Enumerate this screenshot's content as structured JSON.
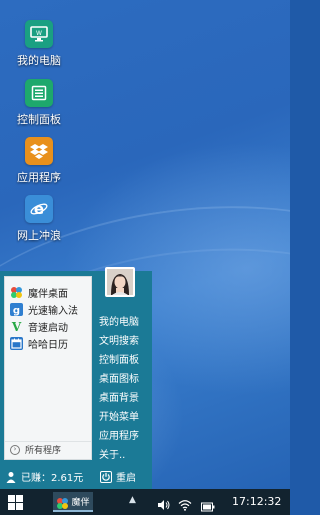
{
  "desktop": {
    "icons": [
      {
        "label": "我的电脑",
        "icon": "computer-icon",
        "color": "#1aa082"
      },
      {
        "label": "控制面板",
        "icon": "control-panel-icon",
        "color": "#1ea86c"
      },
      {
        "label": "应用程序",
        "icon": "dropbox-icon",
        "color": "#e8901c"
      },
      {
        "label": "网上冲浪",
        "icon": "internet-explorer-icon",
        "color": "#3a8ed8"
      }
    ]
  },
  "start_menu": {
    "apps": [
      {
        "label": "魔伴桌面",
        "icon": "pinwheel-icon"
      },
      {
        "label": "光速输入法",
        "icon": "input-method-icon"
      },
      {
        "label": "音速启动",
        "icon": "v-launcher-icon"
      },
      {
        "label": "哈哈日历",
        "icon": "calendar-icon"
      }
    ],
    "all_programs": "所有程序",
    "right_items": [
      "我的电脑",
      "文明搜索",
      "控制面板",
      "桌面图标",
      "桌面背景",
      "开始菜单",
      "应用程序",
      "关于.."
    ],
    "earned": "已赚：2.61元",
    "restart": "重启"
  },
  "taskbar": {
    "app_label": "魔伴",
    "time": "17:12:32"
  },
  "colors": {
    "menu_bg": "#1b7a96",
    "taskbar_bg": "#12232f",
    "desktop_bg": "#2a67bb"
  }
}
